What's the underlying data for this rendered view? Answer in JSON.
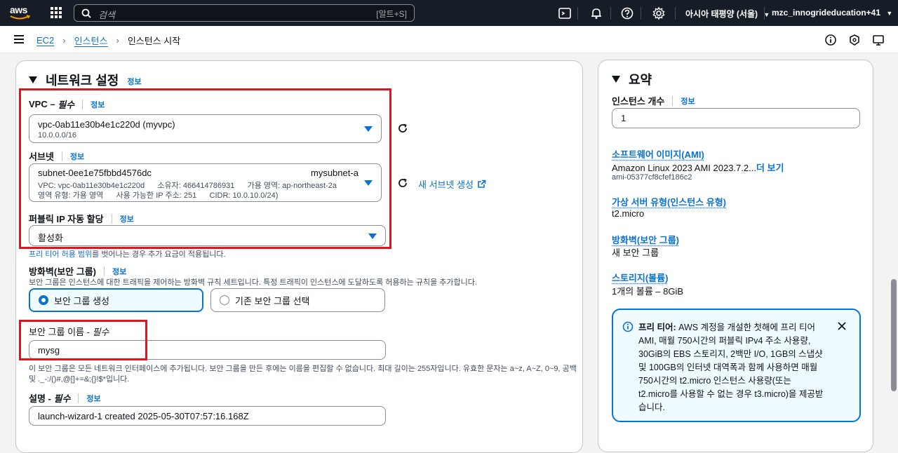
{
  "topnav": {
    "logo": "aws",
    "search_placeholder": "검색",
    "search_shortcut": "[알트+S]",
    "region": "아시아 태평양 (서울)",
    "account": "mzc_innogrideducation+41"
  },
  "breadcrumb": {
    "items": [
      "EC2",
      "인스턴스",
      "인스턴스 시작"
    ]
  },
  "network": {
    "title": "네트워크 설정",
    "info": "정보",
    "vpc": {
      "label": "VPC –",
      "required": "필수",
      "info": "정보",
      "value": "vpc-0ab11e30b4e1c220d (myvpc)",
      "sub": "10.0.0.0/16"
    },
    "subnet": {
      "label": "서브넷",
      "info": "정보",
      "value": "subnet-0ee1e75fbbd4576dc",
      "name": "mysubnet-a",
      "line2": "VPC: vpc-0ab11e30b4e1c220d      소유자: 466414786931      가용 영역: ap-northeast-2a",
      "line3": "영역 유형: 가용 영역      사용 가능한 IP 주소: 251      CIDR: 10.0.10.0/24)",
      "new_subnet": "새 서브넷 생성"
    },
    "public_ip": {
      "label": "퍼블릭 IP 자동 할당",
      "info": "정보",
      "value": "활성화"
    },
    "free_tier_note_link": "프리 티어 허용 범위",
    "free_tier_note": "를 벗어나는 경우 추가 요금이 적용됩니다.",
    "firewall": {
      "label": "방화벽(보안 그룹)",
      "info": "정보",
      "desc": "보안 그룹은 인스턴스에 대한 트래픽을 제어하는 방화벽 규칙 세트입니다. 특정 트래픽이 인스턴스에 도달하도록 허용하는 규칙을 추가합니다.",
      "option_create": "보안 그룹 생성",
      "option_existing": "기존 보안 그룹 선택"
    },
    "sg_name": {
      "label": "보안 그룹 이름 -",
      "required": "필수",
      "value": "mysg",
      "help1": "이 보안 그룹은 모든 네트워크 인터페이스에 추가됩니다. 보안 그룹을 만든 후에는 이름을 편집할 수 없습니다. 최대 길이는 255자입니다. 유효한 문자는 a~z, A~Z, 0~9, 공백",
      "help2": "및 ._-:/()#,@[]+=&;{}!$*입니다."
    },
    "description": {
      "label": "설명 -",
      "required": "필수",
      "info": "정보",
      "value": "launch-wizard-1 created 2025-05-30T07:57:16.168Z"
    }
  },
  "summary": {
    "title": "요약",
    "instance_count_label": "인스턴스 개수",
    "info": "정보",
    "instance_count": "1",
    "ami_link": "소프트웨어 이미지(AMI)",
    "ami_value": "Amazon Linux 2023 AMI 2023.7.2...",
    "ami_more": "더 보기",
    "ami_id": "ami-05377cf8cfef186c2",
    "type_link": "가상 서버 유형(인스턴스 유형)",
    "type_value": "t2.micro",
    "firewall_link": "방화벽(보안 그룹)",
    "firewall_value": "새 보안 그룹",
    "storage_link": "스토리지(볼륨)",
    "storage_value": "1개의 볼륨 – 8GiB",
    "freetier_bold": "프리 티어:",
    "freetier_text": " AWS 계정을 개설한 첫해에 프리 티어 AMI, 매월 750시간의 퍼블릭 IPv4 주소 사용량, 30GiB의 EBS 스토리지, 2백만 I/O, 1GB의 스냅샷 및 100GB의 인터넷 대역폭과 함께 사용하면 매월 750시간의 t2.micro 인스턴스 사용량(또는 t2.micro를 사용할 수 없는 경우 t3.micro)을 제공받습니다."
  },
  "colors": {
    "nav_bg": "#161d26",
    "link": "#0972d3",
    "highlight_red": "#e0161e"
  }
}
